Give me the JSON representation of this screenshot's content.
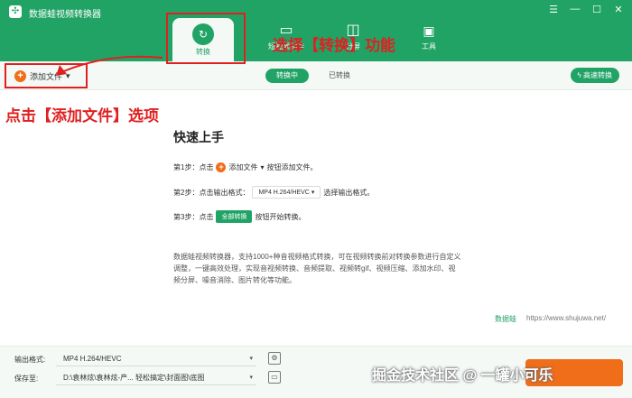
{
  "app": {
    "title": "数据蛙视频转换器",
    "logo_glyph": "✣"
  },
  "window_controls": [
    "☰",
    "—",
    "☐",
    "✕"
  ],
  "top_tabs": [
    {
      "label": "转换",
      "icon": "convert-icon",
      "active": true
    },
    {
      "label": "短视频制作",
      "icon": "tv-icon",
      "active": false
    },
    {
      "label": "分屏",
      "icon": "split-icon",
      "active": false
    },
    {
      "label": "工具",
      "icon": "toolbox-icon",
      "active": false
    }
  ],
  "annotations": {
    "select_convert": "选择【转换】功能",
    "click_add_file": "点击【添加文件】选项"
  },
  "toolbar": {
    "add_file_label": "添加文件",
    "segment_converting": "转换中",
    "segment_converted": "已转换",
    "speed_label": "高速转换"
  },
  "guide": {
    "title": "快速上手",
    "step1_prefix": "第1步：点击",
    "step1_button": "添加文件",
    "step1_suffix": "按钮添加文件。",
    "step2_prefix": "第2步：点击输出格式：",
    "step2_format": "MP4 H.264/HEVC",
    "step2_suffix": "选择输出格式。",
    "step3_prefix": "第3步：点击",
    "step3_button": "全部转换",
    "step3_suffix": "按钮开始转换。",
    "description": "数据蛙视频转换器，支持1000+种音视频格式转换，可在视频转换前对转换参数进行自定义调整，一键高效处理，实现音视频转换、音频提取、视频转gif、视频压缩、添加水印、视频分屏、噪音消除、图片转化等功能。",
    "brand": "数据蛙",
    "url": "https://www.shujuwa.net/"
  },
  "bottom": {
    "output_format_label": "输出格式:",
    "output_format_value": "MP4 H.264/HEVC",
    "save_to_label": "保存至:",
    "save_to_value": "D:\\袁林炫\\袁林炫-产... 轻松搞定\\封面图\\底图"
  },
  "watermark": "掘金技术社区 @ 一罐小可乐",
  "colors": {
    "brand_green": "#21a366",
    "accent_orange": "#f06d1a",
    "annotation_red": "#e02020"
  }
}
